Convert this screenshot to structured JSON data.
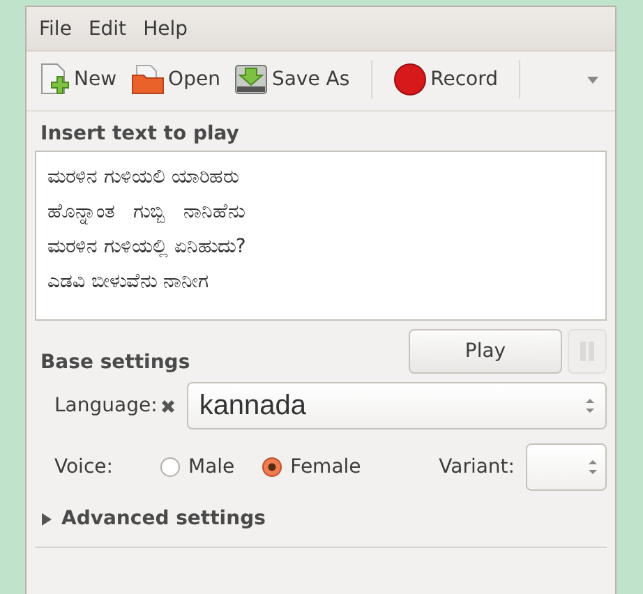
{
  "menu": [
    "File",
    "Edit",
    "Help"
  ],
  "toolbar": [
    {
      "kind": "new",
      "label": "New"
    },
    {
      "kind": "open",
      "label": "Open"
    },
    {
      "kind": "save",
      "label": "Save As"
    },
    {
      "kind": "record",
      "label": "Record"
    }
  ],
  "text_section": {
    "title": "Insert text to play",
    "lines": [
      "ಮರಳಿನ ಗುಳಿಯಲಿ ಯಾರಿಹರು",
      "ಹೊನ್ನಾಂತ   ಗುಬ್ಬಿ   ನಾನಿಹೆನು",
      "ಮರಳಿನ ಗುಳಿಯಲ್ಲಿ ಏನಿಹುದು?",
      "ಎಡವಿ ಬೀಳುವೆನು ನಾನೀಗ"
    ]
  },
  "play_button": "Play",
  "pause_disabled": true,
  "base_settings": {
    "title": "Base settings",
    "language_label": "Language:",
    "language": "kannada",
    "voice_label": "Voice:",
    "voices": [
      {
        "label": "Male",
        "selected": false
      },
      {
        "label": "Female",
        "selected": true
      }
    ],
    "variant_label": "Variant:"
  },
  "advanced": {
    "label": "Advanced settings",
    "expanded": false
  }
}
